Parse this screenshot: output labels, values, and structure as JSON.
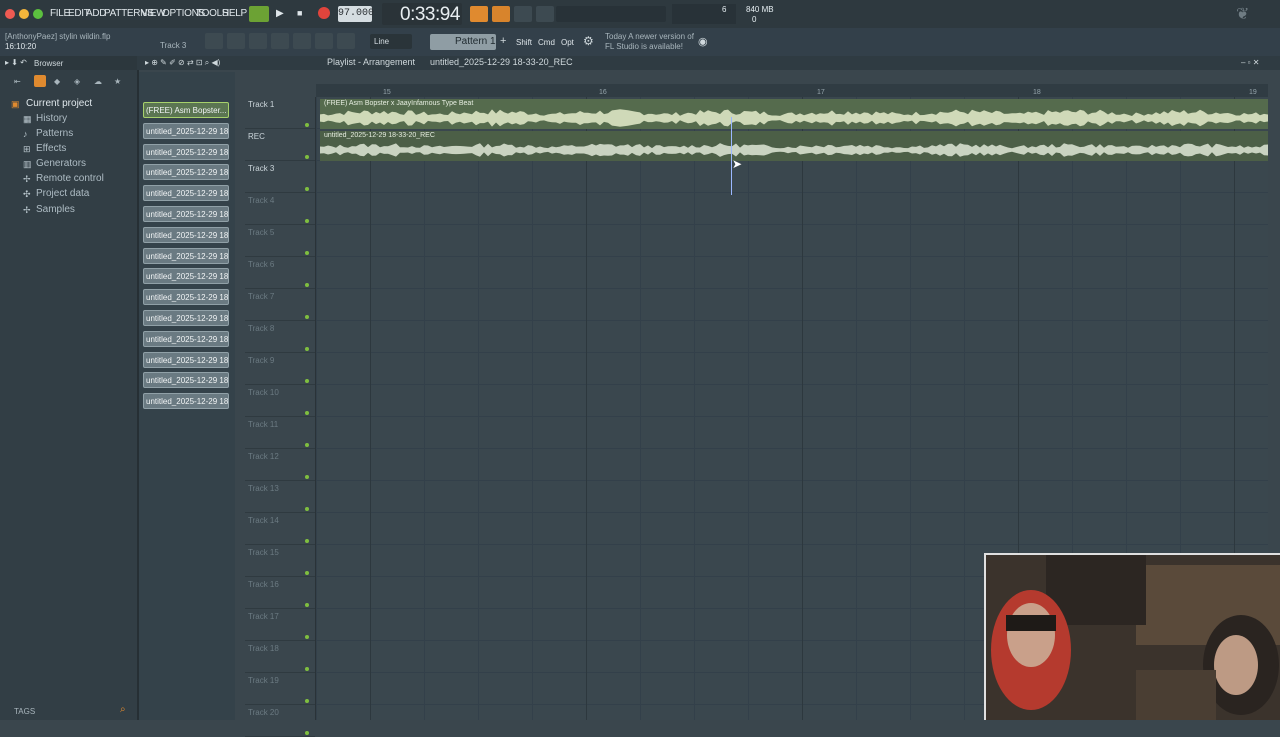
{
  "menu": [
    "FILE",
    "EDIT",
    "ADD",
    "PATTERNS",
    "VIEW",
    "OPTIONS",
    "TOOLS",
    "HELP"
  ],
  "transport": {
    "tempo": "97.000",
    "time": "0:33:94",
    "cpu": "6",
    "mem": "840 MB",
    "poly": "0"
  },
  "project": {
    "file": "[AnthonyPaez] stylin wildin.flp",
    "time": "16:10:20",
    "current_track": "Track 3"
  },
  "toolbar2": {
    "snap": "Line",
    "pattern": "Pattern 1",
    "shift": "Shift",
    "cmd": "Cmd",
    "opt": "Opt",
    "news_line1": "Today  A newer version of",
    "news_line2": "FL Studio is available!"
  },
  "browser": {
    "title": "Browser",
    "items": [
      "Current project",
      "History",
      "Patterns",
      "Effects",
      "Generators",
      "Remote control",
      "Project data",
      "Samples"
    ],
    "tags": "TAGS"
  },
  "playlist": {
    "title": "Playlist - Arrangement",
    "breadcrumb": "untitled_2025-12-29 18-33-20_REC",
    "ruler": [
      "15",
      "16",
      "17",
      "18",
      "19"
    ],
    "clips": [
      "(FREE) Asm Bopster...",
      "untitled_2025-12-29 18-...",
      "untitled_2025-12-29 18-...",
      "untitled_2025-12-29 18-...",
      "untitled_2025-12-29 18-...",
      "untitled_2025-12-29 18-...",
      "untitled_2025-12-29 18-...",
      "untitled_2025-12-29 18-...",
      "untitled_2025-12-29 18-...",
      "untitled_2025-12-29 18-...",
      "untitled_2025-12-29 18-...",
      "untitled_2025-12-29 18-...",
      "untitled_2025-12-29 18-...",
      "untitled_2025-12-29 18-...",
      "untitled_2025-12-29 18-..."
    ],
    "tracks": [
      "Track 1",
      "REC",
      "Track 3",
      "Track 4",
      "Track 5",
      "Track 6",
      "Track 7",
      "Track 8",
      "Track 9",
      "Track 10",
      "Track 11",
      "Track 12",
      "Track 13",
      "Track 14",
      "Track 15",
      "Track 16",
      "Track 17",
      "Track 18",
      "Track 19",
      "Track 20"
    ],
    "audio_clip_1": "(FREE) Asm Bopster x JaayInfamous Type Beat",
    "audio_clip_2": "untitled_2025-12-29 18-33-20_REC"
  },
  "colors": {
    "accent_green": "#7fbf3f",
    "waveform": "#cfd9b8",
    "clip_bg": "#55654c"
  }
}
